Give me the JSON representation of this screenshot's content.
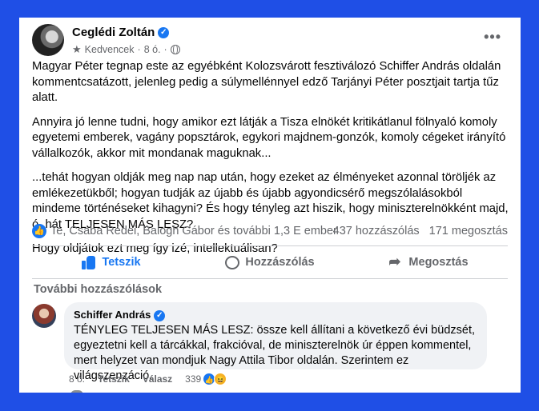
{
  "post": {
    "author": "Ceglédi Zoltán",
    "audience": "Kedvencek",
    "time": "8 ó.",
    "dot": "·",
    "more_menu": "•••",
    "paragraphs": [
      "Magyar Péter tegnap este az egyébként Kolozsvárott fesztiválozó Schiffer András oldalán kommentcsatázott, jelenleg pedig a súlymellénnyel edző Tarjányi Péter posztjait tartja tűz alatt.",
      "Annyira jó lenne tudni, hogy amikor ezt látják a Tisza elnökét kritikátlanul fölnyaló komoly egyetemi emberek, vagány popsztárok, egykori majdnem-gonzók, komoly cégeket irányító vállalkozók, akkor mit mondanak maguknak...",
      "...tehát hogyan oldják meg nap nap után, hogy ezeket az élményeket azonnal töröljék az emlékezetükből; hogyan tudják az újabb és újabb agyondicsérő megszólalásokból mindeme történéseket kihagyni? És hogy tényleg azt hiszik, hogy miniszterelnökként majd, ó, hát TELJESEN MÁS LESZ?",
      "Hogy oldjátok ezt meg így izé, intellektuálisan?"
    ],
    "reactors": "Te, Csaba Rédei, Balogh Gábor és további 1,3 E ember",
    "comment_count": "437 hozzászólás",
    "share_count": "171 megosztás"
  },
  "actions": {
    "like": "Tetszik",
    "comment": "Hozzászólás",
    "share": "Megosztás"
  },
  "comments_section": {
    "more_label": "További hozzászólások",
    "comment": {
      "author": "Schiffer András",
      "text": "TÉNYLEG TELJESEN MÁS LESZ: össze kell állítani a következő évi büdzsét, egyeztetni kell a tárcákkal, frakcióval, de miniszterelnök úr éppen kommentel, mert helyzet van mondjuk Nagy Attila Tibor oldalán. Szerintem ez világszenzáció.",
      "time": "8 ó.",
      "like": "Tetszik",
      "reply": "Válasz",
      "reaction_count": "339"
    }
  },
  "colors": {
    "background": "#1f4fe6",
    "accent": "#1877f2",
    "muted_text": "#65676b"
  }
}
